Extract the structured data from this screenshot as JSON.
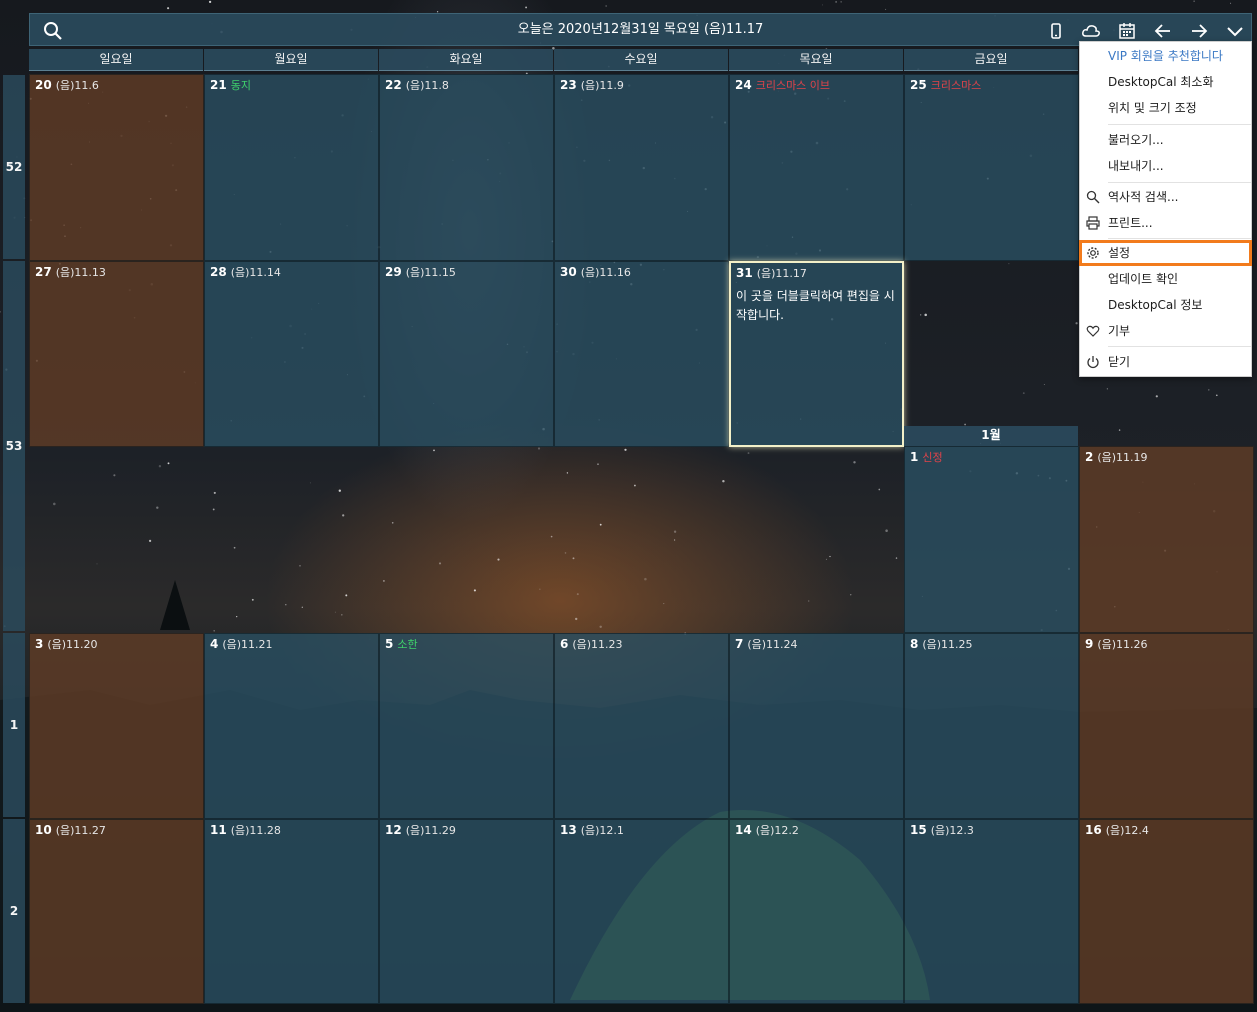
{
  "header": {
    "title": "오늘은 2020년12월31일 목요일 (음)11.17"
  },
  "icons": {
    "search": "search-icon",
    "mobile": "mobile-icon",
    "cloud": "cloud-icon",
    "calendar": "calendar-icon",
    "prev": "arrow-left-icon",
    "next": "arrow-right-icon",
    "menu": "chevron-down-icon"
  },
  "weekdays": [
    "일요일",
    "월요일",
    "화요일",
    "수요일",
    "목요일",
    "금요일"
  ],
  "week_numbers": [
    "52",
    "53",
    "1",
    "2"
  ],
  "month_label": "1월",
  "days": {
    "d20": {
      "num": "20",
      "info": "(음)11.6"
    },
    "d21": {
      "num": "21",
      "info": "동지"
    },
    "d22": {
      "num": "22",
      "info": "(음)11.8"
    },
    "d23": {
      "num": "23",
      "info": "(음)11.9"
    },
    "d24": {
      "num": "24",
      "info": "크리스마스 이브"
    },
    "d25": {
      "num": "25",
      "info": "크리스마스"
    },
    "d27": {
      "num": "27",
      "info": "(음)11.13"
    },
    "d28": {
      "num": "28",
      "info": "(음)11.14"
    },
    "d29": {
      "num": "29",
      "info": "(음)11.15"
    },
    "d30": {
      "num": "30",
      "info": "(음)11.16"
    },
    "d31": {
      "num": "31",
      "info": "(음)11.17",
      "note": "이 곳을 더블클릭하여 편집을 시작합니다."
    },
    "j1": {
      "num": "1",
      "info": "신정"
    },
    "j2": {
      "num": "2",
      "info": "(음)11.19"
    },
    "j3": {
      "num": "3",
      "info": "(음)11.20"
    },
    "j4": {
      "num": "4",
      "info": "(음)11.21"
    },
    "j5": {
      "num": "5",
      "info": "소한"
    },
    "j6": {
      "num": "6",
      "info": "(음)11.23"
    },
    "j7": {
      "num": "7",
      "info": "(음)11.24"
    },
    "j8": {
      "num": "8",
      "info": "(음)11.25"
    },
    "j9": {
      "num": "9",
      "info": "(음)11.26"
    },
    "j10": {
      "num": "10",
      "info": "(음)11.27"
    },
    "j11": {
      "num": "11",
      "info": "(음)11.28"
    },
    "j12": {
      "num": "12",
      "info": "(음)11.29"
    },
    "j13": {
      "num": "13",
      "info": "(음)12.1"
    },
    "j14": {
      "num": "14",
      "info": "(음)12.2"
    },
    "j15": {
      "num": "15",
      "info": "(음)12.3"
    },
    "j16": {
      "num": "16",
      "info": "(음)12.4"
    }
  },
  "menu": {
    "vip": "VIP 회원을 추천합니다",
    "minimize": "DesktopCal 최소화",
    "position": "위치 및 크기 조정",
    "import": "불러오기...",
    "export": "내보내기...",
    "history_search": "역사적 검색...",
    "print": "프린트...",
    "settings": "설정",
    "update": "업데이트 확인",
    "about": "DesktopCal 정보",
    "donate": "기부",
    "close": "닫기",
    "highlight_color": "#f27b1c"
  },
  "colors": {
    "holiday_red": "#e0434a",
    "solar_term_green": "#3fd26b",
    "accent_blue": "#3a78c4"
  }
}
